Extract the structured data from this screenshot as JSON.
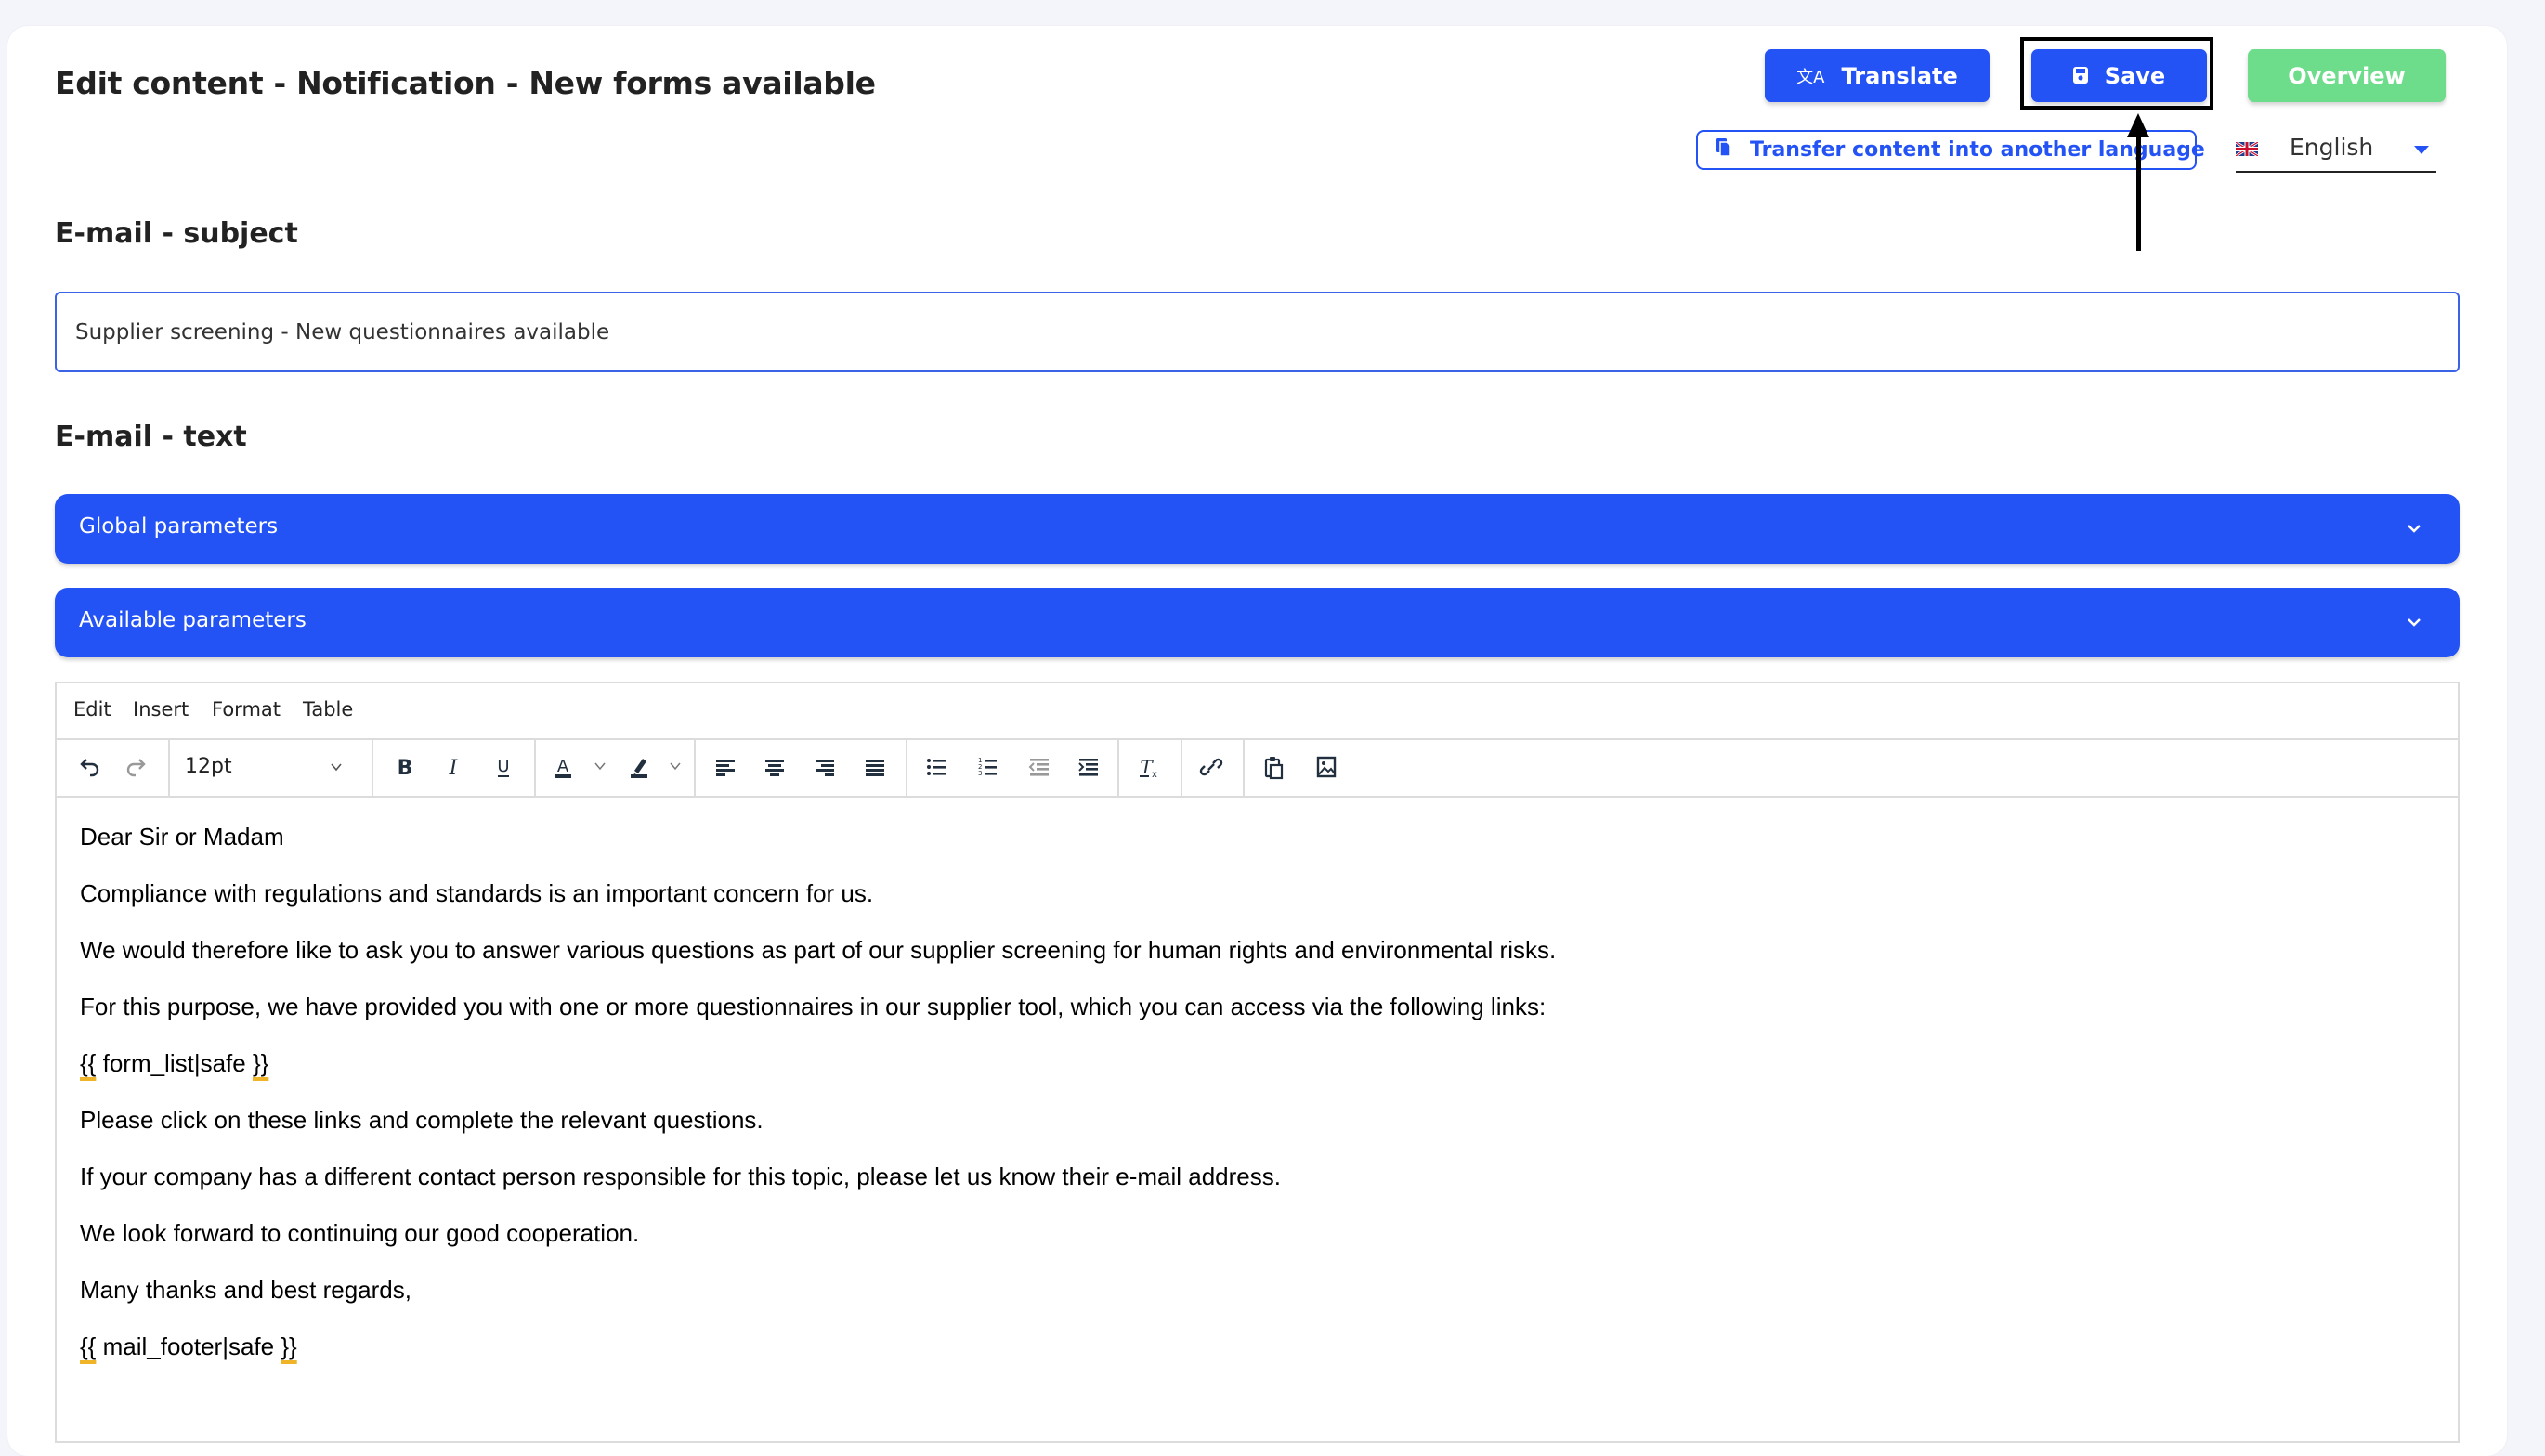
{
  "page": {
    "title": "Edit content - Notification - New forms available"
  },
  "header": {
    "translate_label": "Translate",
    "save_label": "Save",
    "overview_label": "Overview",
    "transfer_label": "Transfer content into another language",
    "language": {
      "selected": "English",
      "flag": "uk-flag"
    }
  },
  "subject": {
    "heading": "E-mail - subject",
    "value": "Supplier screening - New questionnaires available"
  },
  "text": {
    "heading": "E-mail - text",
    "accordions": [
      {
        "label": "Global parameters"
      },
      {
        "label": "Available parameters"
      }
    ]
  },
  "editor": {
    "menu": [
      "Edit",
      "Insert",
      "Format",
      "Table"
    ],
    "font_size": "12pt",
    "toolbar_icons": [
      "undo-icon",
      "redo-icon",
      "bold-icon",
      "italic-icon",
      "underline-icon",
      "text-color-icon",
      "highlight-icon",
      "align-left-icon",
      "align-center-icon",
      "align-right-icon",
      "align-justify-icon",
      "bullet-list-icon",
      "numbered-list-icon",
      "outdent-icon",
      "indent-icon",
      "clear-formatting-icon",
      "link-icon",
      "paste-icon",
      "image-icon"
    ],
    "paragraphs": [
      "Dear Sir or Madam",
      "Compliance with regulations and standards is an important concern for us.",
      "We would therefore like to ask you to answer various questions as part of our supplier screening for human rights and environmental risks.",
      "For this purpose, we have provided you with one or more questionnaires in our supplier tool, which you can access via the following links:",
      "{{ form_list|safe }}",
      "Please click on these links and complete the relevant questions.",
      "If your company has a different contact person responsible for this topic, please let us know their e-mail address.",
      "We look forward to continuing our good cooperation.",
      "Many thanks and best regards,",
      "{{ mail_footer|safe }}"
    ]
  },
  "colors": {
    "primary": "#2453f5",
    "success": "#6ddc8b",
    "background": "#f4f5fa",
    "annotation": "#000000"
  }
}
